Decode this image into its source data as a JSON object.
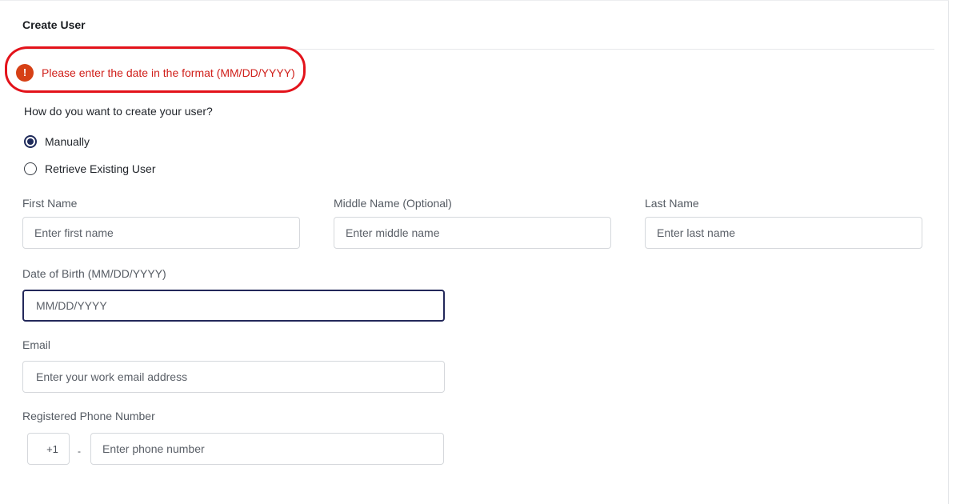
{
  "page": {
    "title": "Create User"
  },
  "error": {
    "icon": "exclamation-icon",
    "icon_glyph": "!",
    "message": "Please enter the date in the format (MM/DD/YYYY)",
    "color": "#d0201b"
  },
  "creation_method": {
    "question": "How do you want to create your user?",
    "options": [
      {
        "label": "Manually",
        "selected": true
      },
      {
        "label": "Retrieve Existing User",
        "selected": false
      }
    ]
  },
  "fields": {
    "first_name": {
      "label": "First Name",
      "placeholder": "Enter first name",
      "value": ""
    },
    "middle_name": {
      "label": "Middle Name (Optional)",
      "placeholder": "Enter middle name",
      "value": ""
    },
    "last_name": {
      "label": "Last Name",
      "placeholder": "Enter last name",
      "value": ""
    },
    "dob": {
      "label": "Date of Birth (MM/DD/YYYY)",
      "placeholder": "MM/DD/YYYY",
      "value": ""
    },
    "email": {
      "label": "Email",
      "placeholder": "Enter your work email address",
      "value": ""
    },
    "phone": {
      "label": "Registered Phone Number",
      "country_code": "+1",
      "separator": "-",
      "placeholder": "Enter phone number",
      "value": ""
    }
  },
  "colors": {
    "focus_border": "#23285a",
    "radio_selected": "#1e2a5a",
    "error_outline": "#e3131b"
  }
}
